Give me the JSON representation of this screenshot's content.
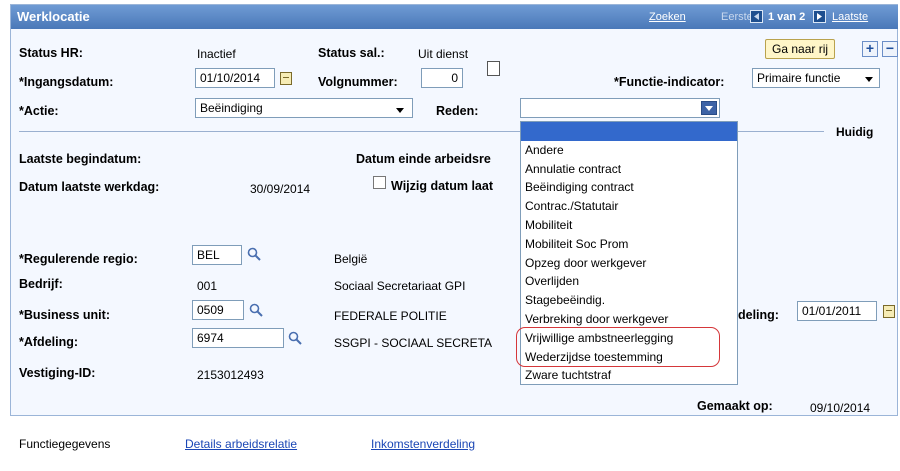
{
  "titlebar": {
    "title": "Werklocatie",
    "search_link": "Zoeken",
    "first_label": "Eerste",
    "pager": "1 van 2",
    "last_link": "Laatste"
  },
  "status_hr": {
    "label": "Status HR:",
    "value": "Inactief"
  },
  "status_sal": {
    "label": "Status sal.:",
    "value": "Uit dienst"
  },
  "goto_row_button": "Ga naar rij",
  "add_row_button": "+",
  "remove_row_button": "−",
  "ingangsdatum": {
    "label": "*Ingangsdatum:",
    "value": "01/10/2014"
  },
  "volgnummer": {
    "label": "Volgnummer:",
    "value": "0"
  },
  "functie_indicator": {
    "label": "*Functie-indicator:",
    "value": "Primaire functie"
  },
  "actie": {
    "label": "*Actie:",
    "value": "Beëindiging"
  },
  "reden": {
    "label": "Reden:",
    "value": "",
    "options": [
      "",
      "Andere",
      "Annulatie contract",
      "Beëindiging contract",
      "Contrac./Statutair",
      "Mobiliteit",
      "Mobiliteit Soc Prom",
      "Opzeg door werkgever",
      "Overlijden",
      "Stagebeëindig.",
      "Verbreking door werkgever",
      "Vrijwillige ambstneerlegging",
      "Wederzijdse toestemming",
      "Zware tuchtstraf"
    ]
  },
  "huidig_label": "Huidig",
  "laatste_begindatum": {
    "label": "Laatste begindatum:"
  },
  "datum_einde": {
    "label": "Datum einde arbeidsre"
  },
  "datum_laatste_werkdag": {
    "label": "Datum laatste werkdag:",
    "value": "30/09/2014"
  },
  "wijzig_datum": {
    "label": "Wijzig datum laat"
  },
  "regulerende_regio": {
    "label": "*Regulerende regio:",
    "value": "BEL",
    "desc": "België"
  },
  "bedrijf": {
    "label": "Bedrijf:",
    "value": "001",
    "desc": "Sociaal Secretariaat GPI"
  },
  "business_unit": {
    "label": "*Business unit:",
    "value": "0509",
    "desc": "FEDERALE POLITIE"
  },
  "afdeling_date": {
    "label": "deling:",
    "value": "01/01/2011"
  },
  "afdeling": {
    "label": "*Afdeling:",
    "value": "6974",
    "desc": "SSGPI - SOCIAAL SECRETA"
  },
  "vestiging": {
    "label": "Vestiging-ID:",
    "value": "2153012493"
  },
  "gemaakt_op": {
    "label": "Gemaakt op:",
    "value": "09/10/2014"
  },
  "bottom_tabs": [
    "Functiegegevens",
    "Details arbeidsrelatie",
    "Inkomstenverdeling"
  ]
}
